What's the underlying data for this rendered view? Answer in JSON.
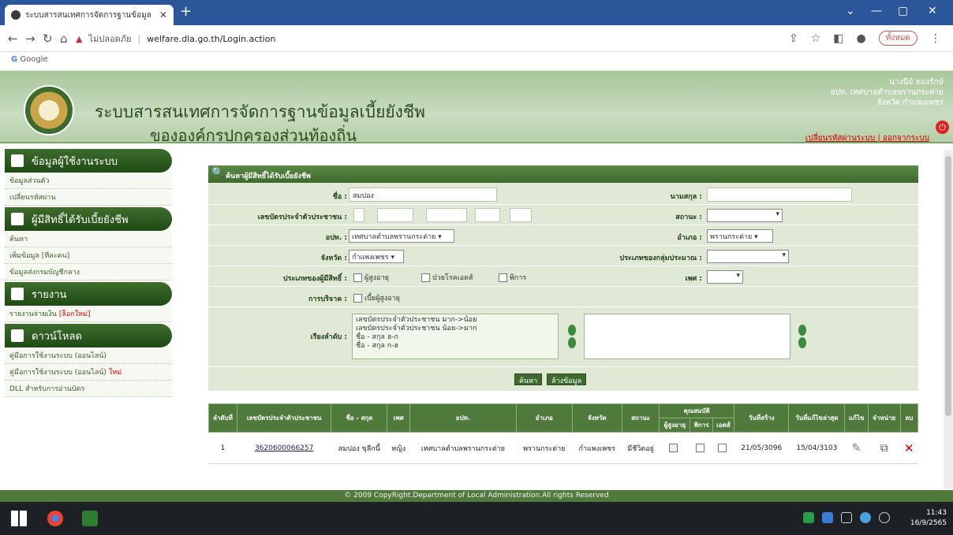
{
  "browser": {
    "tab_title": "ระบบสารสนเทศการจัดการฐานข้อมูล",
    "url_warning": "ไม่ปลอดภัย",
    "url": "welfare.dla.go.th/Login.action",
    "profile_label": "ทั้งหมด",
    "bookmark": "Google"
  },
  "header": {
    "title_line1": "ระบบสารสนเทศการจัดการฐานข้อมูลเบี้ยยังชีพ",
    "title_line2": "ขององค์กรปกครองส่วนท้องถิ่น",
    "user_name": "นางนีย์ ทองรักษ์",
    "user_org": "อปท. เทศบาลตำบลพรานกระต่าย",
    "user_province": "จังหวัด กำแพงเพชร",
    "user_links": "เปลี่ยนรหัสผ่านระบบ | ออกจากระบบ"
  },
  "sidebar": {
    "sections": [
      {
        "title": "ข้อมูลผู้ใช้งานระบบ",
        "items": [
          "ข้อมูลส่วนตัว",
          "เปลี่ยนรหัสผ่าน"
        ]
      },
      {
        "title": "ผู้มีสิทธิ์ได้รับเบี้ยยังชีพ",
        "items": [
          "ค้นหา",
          "เพิ่มข้อมูล [ทีละคน]",
          "ข้อมูลส่งกรมบัญชีกลาง"
        ]
      },
      {
        "title": "รายงาน",
        "items": [
          "รายงานจ่ายเงิน"
        ],
        "item_new": "[ล็อกใหม่]"
      },
      {
        "title": "ดาวน์โหลด",
        "items": [
          "คู่มือการใช้งานระบบ (ออนไลน์)",
          "คู่มือการใช้งานระบบ (ออนไลน์)",
          "DLL สำหรับการอ่านบัตร"
        ],
        "item2_new": "ใหม่"
      }
    ]
  },
  "search": {
    "header": "ค้นหาผู้มีสิทธิ์ได้รับเบี้ยยังชีพ",
    "label_name": "ชื่อ :",
    "name_value": "สมปอง",
    "label_surname": "นามสกุล :",
    "label_idcard": "เลขบัตรประจำตัวประชาชน :",
    "label_status": "สถานะ :",
    "label_org": "อปท. :",
    "org_value": "เทศบาลตำบลพรานกระต่าย",
    "label_district": "อำเภอ :",
    "district_value": "พรานกระต่าย",
    "label_province": "จังหวัด :",
    "province_value": "กำแพงเพชร",
    "label_group": "ประเภทของกลุ่มประมาณ :",
    "label_type": "ประเภทของผู้มีสิทธิ์ :",
    "type_opts": [
      "ผู้สูงอายุ",
      "ป่วยโรคเอดส์",
      "พิการ"
    ],
    "label_gender": "เพศ :",
    "label_cancel": "การบริจาค :",
    "cancel_opt": "เบี้ยผู้สูงอายุ",
    "label_sort": "เรียงลำดับ :",
    "sort_opts": [
      "เลขบัตรประจำตัวประชาชน มาก->น้อย",
      "เลขบัตรประจำตัวประชาชน น้อย->มาก",
      "ชื่อ - สกุล ฮ-ก",
      "ชื่อ - สกุล ก-ฮ"
    ],
    "btn_search": "ค้นหา",
    "btn_clear": "ล้างข้อมูล"
  },
  "table": {
    "headers": [
      "ลำดับที่",
      "เลขบัตรประจำตัวประชาชน",
      "ชื่อ - สกุล",
      "เพศ",
      "อปท.",
      "อำเภอ",
      "จังหวัด",
      "สถานะ",
      "คุณสมบัติ",
      "วันที่สร้าง",
      "วันที่แก้ไขล่าสุด",
      "แก้ไข",
      "จำหน่าย",
      "ลบ"
    ],
    "sub_headers": [
      "ผู้สูงอายุ",
      "พิการ",
      "เอดส์"
    ],
    "rows": [
      {
        "no": "1",
        "id": "3620600066257",
        "name": "สมปอง ขุลีกนี้",
        "gender": "หญิง",
        "org": "เทศบาลตำบลพรานกระต่าย",
        "district": "พรานกระต่าย",
        "province": "กำแพงเพชร",
        "status": "มีชีวิตอยู่",
        "created": "21/05/3096",
        "updated": "15/04/3103"
      }
    ]
  },
  "footer": "© 2009 CopyRight.Department of Local Administration.All rights Reserved",
  "taskbar": {
    "time": "11:43",
    "date": "16/9/2565"
  }
}
